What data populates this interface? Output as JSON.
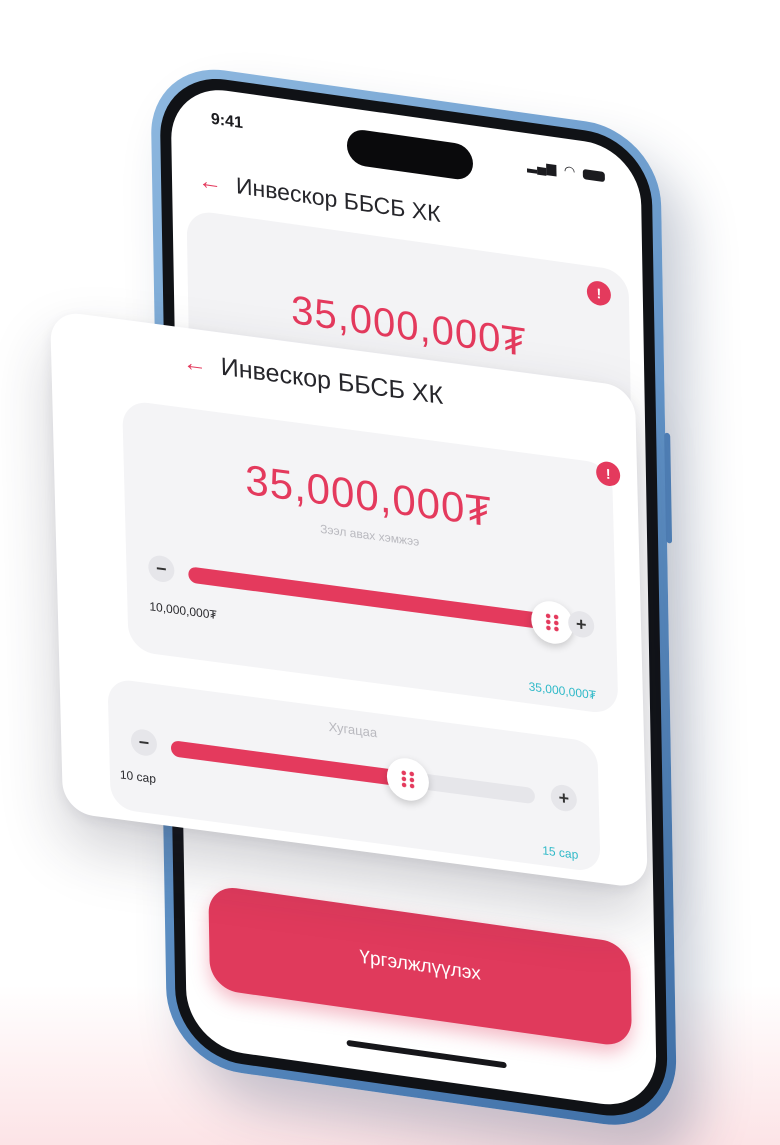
{
  "status_bar": {
    "time": "9:41"
  },
  "background_screen": {
    "title": "Инвескор ББСБ ХК",
    "amount": "35,000,000₮",
    "amount_label": "Зээл авах хэмжээ",
    "amount_fraction": 0.85
  },
  "card": {
    "title": "Инвескор ББСБ ХК",
    "amount": "35,000,000₮",
    "amount_label": "Зээл авах хэмжээ",
    "amount_slider": {
      "min_label": "10,000,000₮",
      "max_label": "35,000,000₮",
      "fraction": 1.0
    },
    "term": {
      "label": "Хугацаа",
      "min_label": "10 сар",
      "max_label": "15 сар",
      "fraction": 0.65
    }
  },
  "cta": {
    "label": "Үргэлжлүүлэх"
  },
  "colors": {
    "accent": "#e43a5d",
    "secondary": "#2fb9c8",
    "phone_frame": "#5d8fc4"
  },
  "icons": {
    "back": "←",
    "info": "!",
    "minus": "−",
    "plus": "+",
    "signal": "▂▄▆",
    "wifi": "◠"
  }
}
